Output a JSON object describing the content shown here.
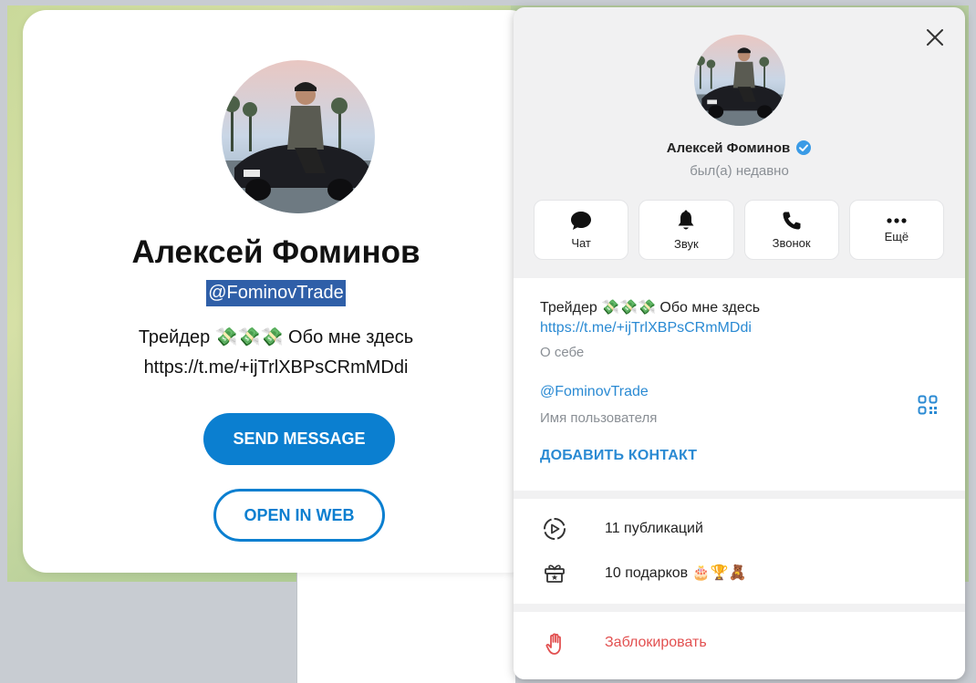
{
  "preview": {
    "name": "Алексей Фоминов",
    "username": "@FominovTrade",
    "bio_line1": "Трейдер 💸💸💸 Обо мне здесь",
    "bio_line2": "https://t.me/+ijTrlXBPsCRmMDdi",
    "send_button": "SEND MESSAGE",
    "web_button": "OPEN IN WEB"
  },
  "panel": {
    "name": "Алексей Фоминов",
    "verified_icon": "verified-badge-icon",
    "status": "был(а) недавно",
    "actions": [
      {
        "label": "Чат",
        "icon": "chat-icon"
      },
      {
        "label": "Звук",
        "icon": "bell-icon"
      },
      {
        "label": "Звонок",
        "icon": "phone-icon"
      },
      {
        "label": "Ещё",
        "icon": "more-icon"
      }
    ],
    "bio": "Трейдер 💸💸💸 Обо мне здесь",
    "bio_link": "https://t.me/+ijTrlXBPsCRmMDdi",
    "bio_label": "О себе",
    "username": "@FominovTrade",
    "username_label": "Имя пользователя",
    "add_contact": "ДОБАВИТЬ КОНТАКТ",
    "posts": "11 публикаций",
    "gifts": "10 подарков 🎂🏆🧸",
    "block": "Заблокировать"
  },
  "colors": {
    "accent": "#2a8ad3",
    "button_blue": "#0b7fd0",
    "danger": "#e25050",
    "selection": "#2f5fa8"
  }
}
